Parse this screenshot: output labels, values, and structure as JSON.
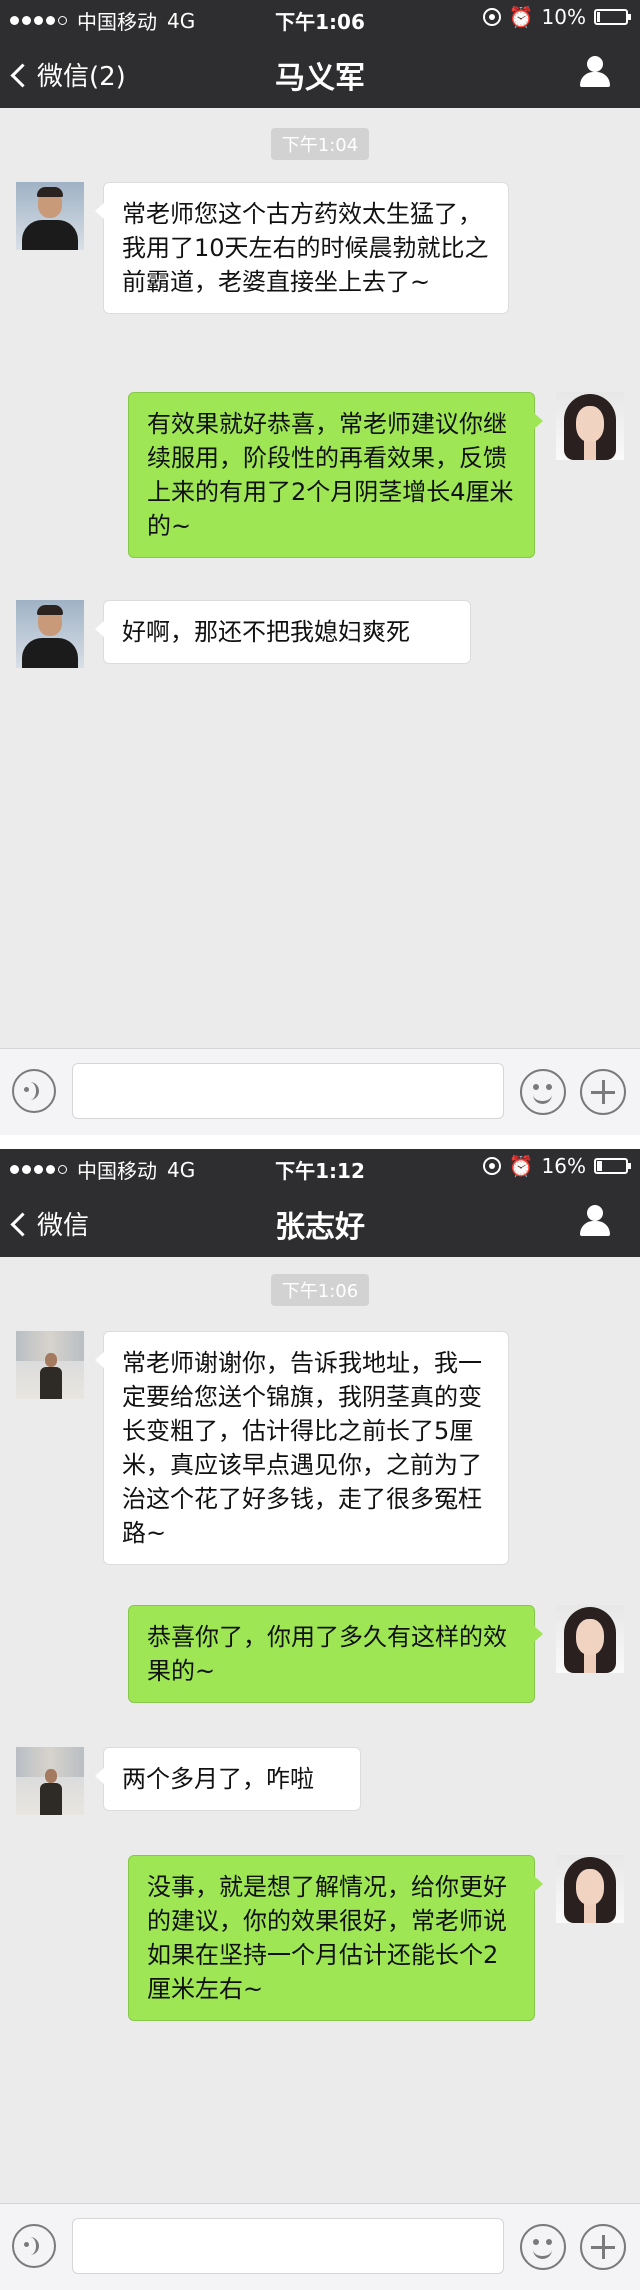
{
  "screens": [
    {
      "status": {
        "carrier": "中国移动",
        "network": "4G",
        "time": "下午1:06",
        "battery": "10%",
        "battery_level": 0.1
      },
      "nav": {
        "back_label": "微信(2)",
        "title": "马义军"
      },
      "timestamp": "下午1:04",
      "messages": [
        {
          "from": "them",
          "text": "常老师您这个古方药效太生猛了，我用了10天左右的时候晨勃就比之前霸道，老婆直接坐上去了~"
        },
        {
          "from": "me",
          "text": "有效果就好恭喜，常老师建议你继续服用，阶段性的再看效果，反馈上来的有用了2个月阴茎增长4厘米的~"
        },
        {
          "from": "them",
          "text": "好啊，那还不把我媳妇爽死"
        }
      ]
    },
    {
      "status": {
        "carrier": "中国移动",
        "network": "4G",
        "time": "下午1:12",
        "battery": "16%",
        "battery_level": 0.16
      },
      "nav": {
        "back_label": "微信",
        "title": "张志好"
      },
      "timestamp": "下午1:06",
      "messages": [
        {
          "from": "them",
          "text": "常老师谢谢你，告诉我地址，我一定要给您送个锦旗，我阴茎真的变长变粗了，估计得比之前长了5厘米，真应该早点遇见你，之前为了治这个花了好多钱，走了很多冤枉路~"
        },
        {
          "from": "me",
          "text": "恭喜你了，你用了多久有这样的效果的~"
        },
        {
          "from": "them",
          "text": "两个多月了，咋啦"
        },
        {
          "from": "me",
          "text": "没事，就是想了解情况，给你更好的建议，你的效果很好，常老师说如果在坚持一个月估计还能长个2厘米左右~"
        }
      ]
    }
  ]
}
